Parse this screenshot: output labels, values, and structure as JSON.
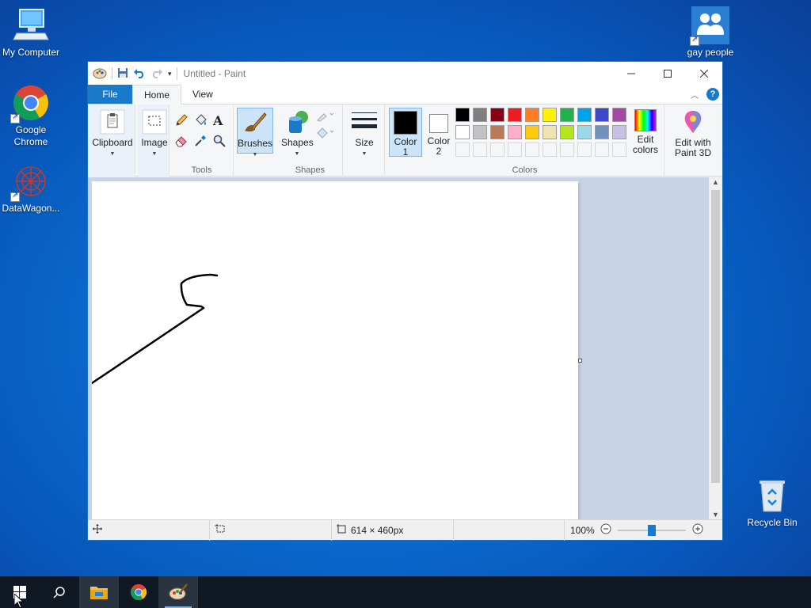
{
  "desktop": {
    "icons": [
      {
        "label": "My Computer",
        "icon": "computer-icon"
      },
      {
        "label": "Google Chrome",
        "icon": "chrome-icon"
      },
      {
        "label": "DataWagon...",
        "icon": "datawagon-icon"
      },
      {
        "label": "gay people",
        "icon": "people-icon"
      },
      {
        "label": "Recycle Bin",
        "icon": "recycle-bin-icon"
      }
    ]
  },
  "window": {
    "title": "Untitled - Paint",
    "tabs": [
      "File",
      "Home",
      "View"
    ],
    "active_tab": "Home"
  },
  "ribbon": {
    "clipboard": "Clipboard",
    "image": "Image",
    "tools_label": "Tools",
    "brushes": "Brushes",
    "shapes": "Shapes",
    "shapes_label": "Shapes",
    "size": "Size",
    "color1": "Color\n1",
    "color1_a": "Color",
    "color1_b": "1",
    "color2_a": "Color",
    "color2_b": "2",
    "edit_colors_a": "Edit",
    "edit_colors_b": "colors",
    "paint3d_a": "Edit with",
    "paint3d_b": "Paint 3D",
    "colors_label": "Colors"
  },
  "palette": {
    "row1": [
      "#000000",
      "#7f7f7f",
      "#880015",
      "#ed1c24",
      "#ff7f27",
      "#fff200",
      "#22b14c",
      "#00a2e8",
      "#3f48cc",
      "#a349a4"
    ],
    "row2": [
      "#ffffff",
      "#c3c3c3",
      "#b97a57",
      "#ffaec9",
      "#ffc90e",
      "#efe4b0",
      "#b5e61d",
      "#99d9ea",
      "#7092be",
      "#c8bfe7"
    ],
    "color1": "#000000",
    "color2": "#ffffff"
  },
  "status": {
    "canvas_size": "614 × 460px",
    "zoom": "100%",
    "zoom_fraction": 0.5
  }
}
